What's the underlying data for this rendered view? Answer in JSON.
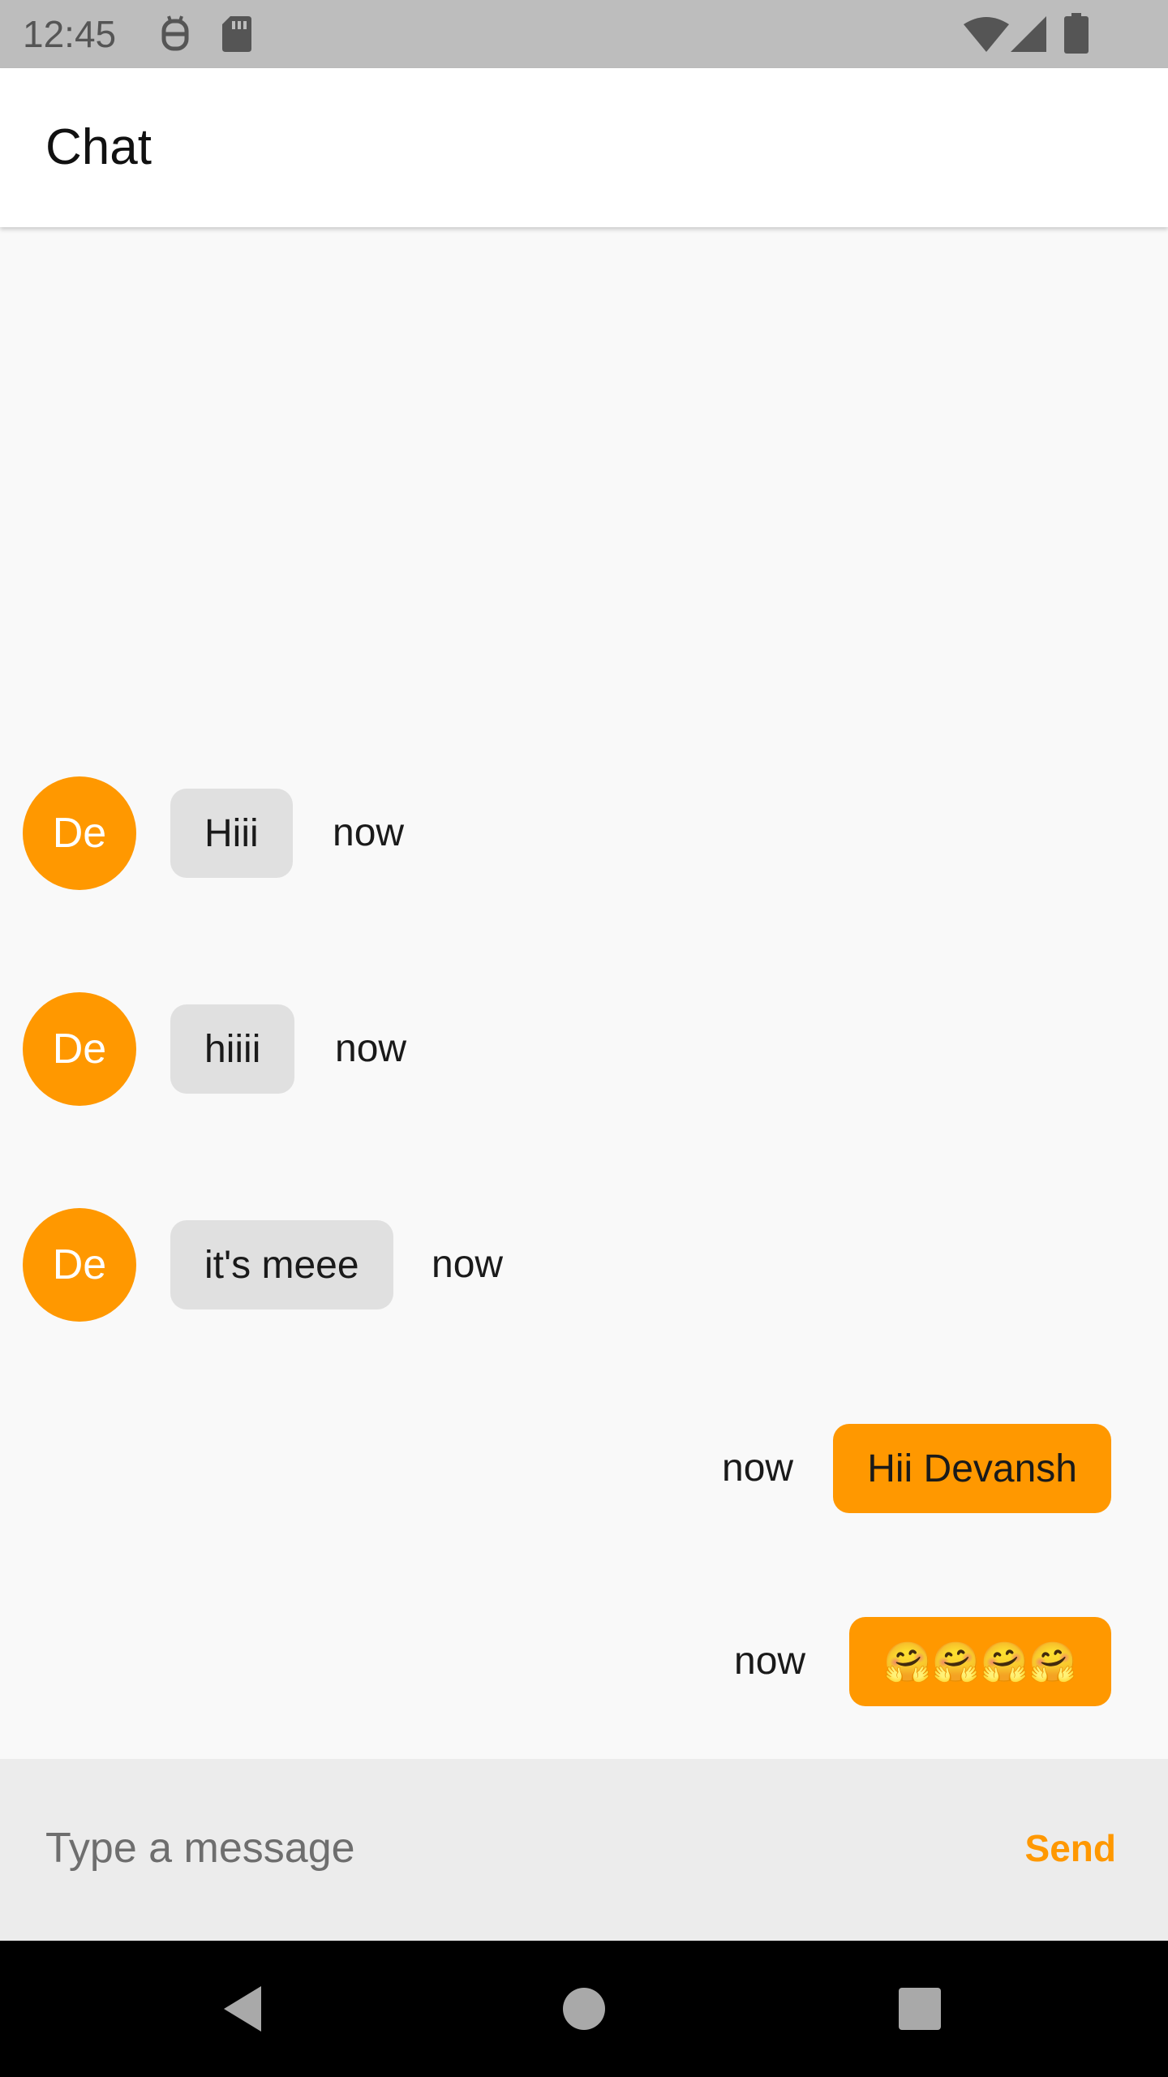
{
  "status_bar": {
    "time": "12:45",
    "left_icons": [
      "debug-icon",
      "sd-card-icon"
    ],
    "right_icons": [
      "wifi-icon",
      "cell-signal-icon",
      "battery-icon"
    ],
    "color": "#bdbdbd"
  },
  "app_bar": {
    "title": "Chat"
  },
  "accent_color": "#ff9800",
  "incoming_bubble_color": "#e0e0e0",
  "messages": [
    {
      "direction": "incoming",
      "avatar": "De",
      "text": "Hiii",
      "time": "now"
    },
    {
      "direction": "incoming",
      "avatar": "De",
      "text": "hiiii",
      "time": "now"
    },
    {
      "direction": "incoming",
      "avatar": "De",
      "text": "it's meee",
      "time": "now"
    },
    {
      "direction": "outgoing",
      "text": "Hii Devansh",
      "time": "now"
    },
    {
      "direction": "outgoing",
      "text": "🤗🤗🤗🤗",
      "time": "now"
    }
  ],
  "composer": {
    "placeholder": "Type a message",
    "send_label": "Send"
  },
  "nav_bar": {
    "buttons": [
      "back-icon",
      "home-icon",
      "recents-icon"
    ]
  }
}
